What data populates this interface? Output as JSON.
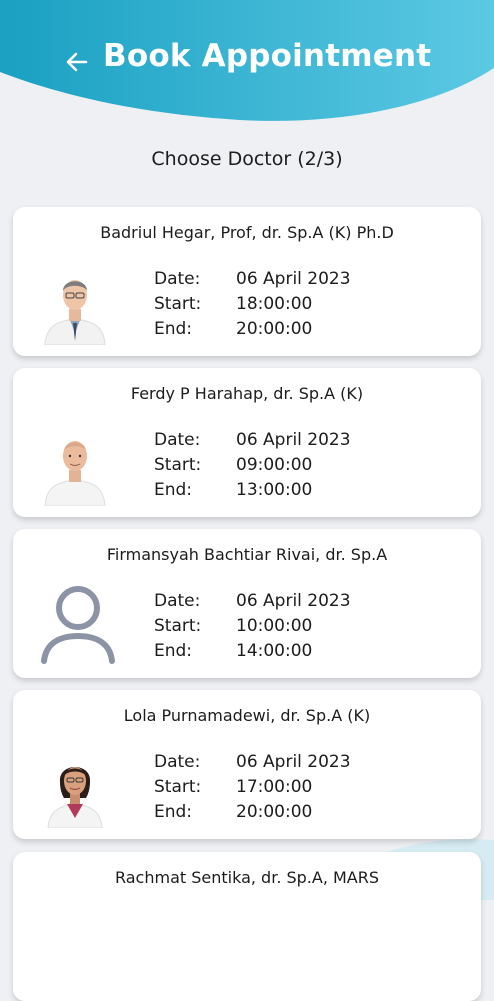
{
  "header": {
    "title": "Book Appointment",
    "back_icon": "arrow-left-icon",
    "gradient": [
      "#1aa0c2",
      "#5cc9e4"
    ]
  },
  "step_title": "Choose Doctor (2/3)",
  "labels": {
    "date": "Date:",
    "start": "Start:",
    "end": "End:"
  },
  "doctors": [
    {
      "name": "Badriul Hegar, Prof, dr. Sp.A (K) Ph.D",
      "date": "06 April 2023",
      "start": "18:00:00",
      "end": "20:00:00",
      "avatar": "photo-male-glasses"
    },
    {
      "name": "Ferdy P Harahap, dr. Sp.A (K)",
      "date": "06 April 2023",
      "start": "09:00:00",
      "end": "13:00:00",
      "avatar": "photo-male-bald"
    },
    {
      "name": "Firmansyah Bachtiar Rivai, dr. Sp.A",
      "date": "06 April 2023",
      "start": "10:00:00",
      "end": "14:00:00",
      "avatar": "person-placeholder-icon"
    },
    {
      "name": "Lola Purnamadewi, dr. Sp.A (K)",
      "date": "06 April 2023",
      "start": "17:00:00",
      "end": "20:00:00",
      "avatar": "photo-female"
    },
    {
      "name": "Rachmat Sentika, dr. Sp.A, MARS",
      "date": "",
      "start": "",
      "end": "",
      "avatar": ""
    }
  ]
}
